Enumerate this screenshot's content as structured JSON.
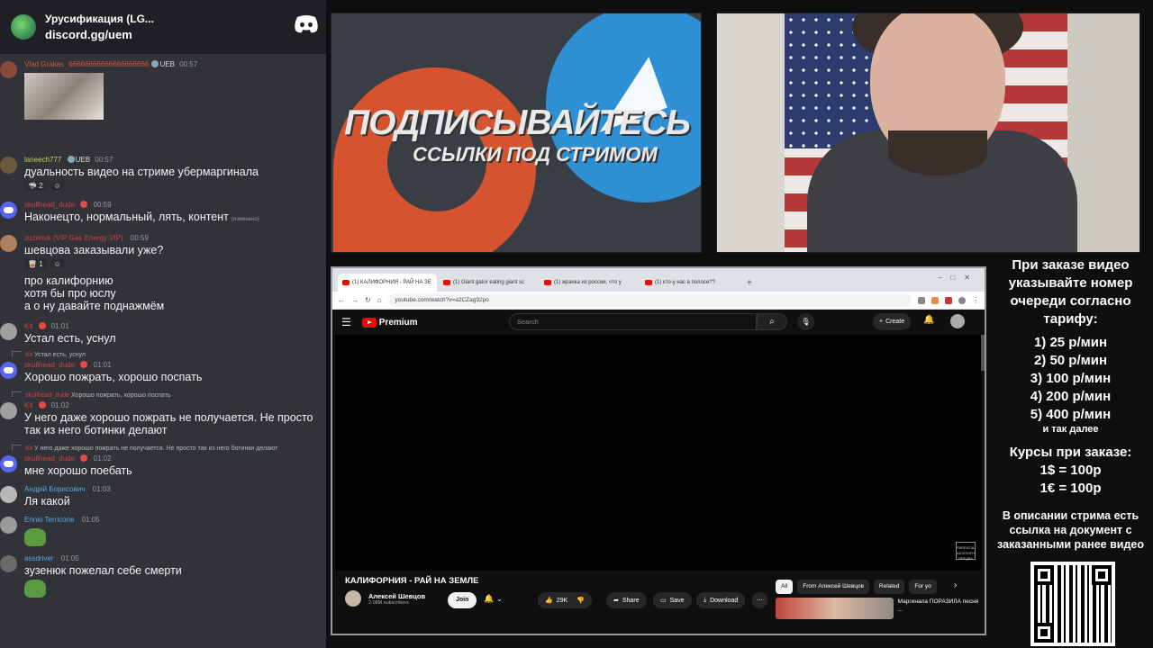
{
  "discord": {
    "server_title": "Урусификация (LG...",
    "invite": "discord.gg/uem",
    "messages": [
      {
        "name": "Vlad Grakas",
        "text_inline": "66666666666666666666",
        "tag": "UEB",
        "time": "00:57",
        "text": "",
        "has_image": true
      },
      {
        "name": "laneech777",
        "tag": "UEB",
        "time": "00:57",
        "text": "дуальность видео на стриме убермаргинала",
        "reactions": [
          "2",
          ""
        ]
      },
      {
        "name": "skullhead_dude",
        "time": "00:59",
        "text": "Наконецто, нормальный, лять, контент",
        "edited": "(изменено)"
      },
      {
        "name": "zuzenuk (VIP Gas Energy VIP)",
        "time": "00:59",
        "text": "шевцова заказывали уже?",
        "reactions": [
          "1",
          ""
        ],
        "extra_lines": [
          "про калифорнию",
          "хотя бы про юслу",
          "а о ну давайте поднажмём"
        ]
      },
      {
        "name": "Kit",
        "time": "01:01",
        "text": "Устал есть, уснул"
      },
      {
        "reply": "Устал есть, уснул",
        "reply_name": "Kit",
        "name": "skullhead_dude",
        "time": "01:01",
        "text": "Хорошо пожрать, хорошо поспать"
      },
      {
        "reply": "Хорошо пожрать, хорошо поспать",
        "reply_name": "skullhead_dude",
        "name": "Kit",
        "time": "01:02",
        "text": "У него даже хорошо пожрать не получается. Не просто так из него ботинки делают"
      },
      {
        "reply": "У него даже хорошо пожрать не получается. Не просто так из него ботинки делают",
        "reply_name": "Kit",
        "name": "skullhead_dude",
        "time": "01:02",
        "text": "мне хорошо поебать"
      },
      {
        "name": "Андрій Борисович",
        "time": "01:03",
        "text": "Ля какой"
      },
      {
        "name": "Ennio Terricone",
        "time": "01:05",
        "text": ""
      },
      {
        "name": "assdriver",
        "time": "01:05",
        "text": "зузенюк пожелал себе смерти"
      }
    ]
  },
  "banner": {
    "title": "ПОДПИСЫВАЙТЕСЬ",
    "subtitle": "ССЫЛКИ ПОД СТРИМОМ"
  },
  "browser": {
    "tabs": [
      "(1) КАЛИФОРНИЯ - РАЙ НА ЗЕ",
      "(1) Giant gator eating giant sc",
      "(1) жрачка из россии, что у",
      "(1) кто-у нас в полосе??"
    ],
    "new_tab": "+",
    "url": "youtube.com/watch?v=a2CZag92po"
  },
  "youtube": {
    "brand": "Premium",
    "search_placeholder": "Search",
    "create_label": "Create",
    "video_title": "КАЛИФОРНИЯ - РАЙ НА ЗЕМЛЕ",
    "channel_name": "Алексей Шевцов",
    "subscribers": "2.08M subscribers",
    "join_label": "Join",
    "likes": "29K",
    "share_label": "Share",
    "save_label": "Save",
    "download_label": "Download",
    "chips": [
      "All",
      "From Алексей Шевцов",
      "Related",
      "For yo"
    ],
    "rec_title": "Маргинала ПОРАЗИЛА песня ...",
    "watermark": "PARENTAL ADVISORY ПРЕДВА"
  },
  "info": {
    "order_text": "При заказе видео указывайте номер очереди согласно тарифу:",
    "rates": [
      "1) 25 р/мин",
      "2) 50 р/мин",
      "3) 100 р/мин",
      "4) 200 р/мин",
      "5) 400 р/мин"
    ],
    "etc": "и так далее",
    "courses_title": "Курсы при заказе:",
    "courses": [
      "1$ = 100р",
      "1€ = 100р"
    ],
    "desc": "В описании стрима есть ссылка на документ с заказанными ранее видео"
  }
}
